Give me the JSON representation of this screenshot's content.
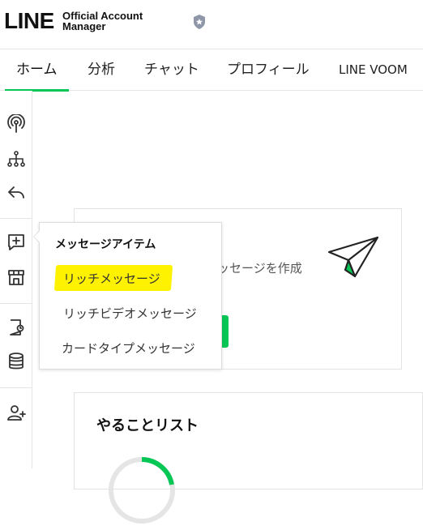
{
  "header": {
    "logo_main": "LINE",
    "logo_sub_line1": "Official Account",
    "logo_sub_line2": "Manager",
    "badge_icon": "shield-star-icon"
  },
  "tabs": [
    {
      "label": "ホーム",
      "active": true
    },
    {
      "label": "分析",
      "active": false
    },
    {
      "label": "チャット",
      "active": false
    },
    {
      "label": "プロフィール",
      "active": false
    },
    {
      "label": "LINE VOOM",
      "active": false
    }
  ],
  "sidebar": {
    "icons": [
      "broadcast-icon",
      "hierarchy-icon",
      "reply-icon",
      "message-add-icon",
      "store-icon",
      "coupon-icon",
      "database-icon",
      "add-user-icon"
    ]
  },
  "main": {
    "create_text": "ッセージを作成",
    "todo_title": "やることリスト",
    "accent": "#06c755"
  },
  "dropdown": {
    "title": "メッセージアイテム",
    "items": [
      {
        "label": "リッチメッセージ",
        "highlighted": true
      },
      {
        "label": "リッチビデオメッセージ",
        "highlighted": false
      },
      {
        "label": "カードタイプメッセージ",
        "highlighted": false
      }
    ],
    "highlight_color": "#fff200"
  }
}
